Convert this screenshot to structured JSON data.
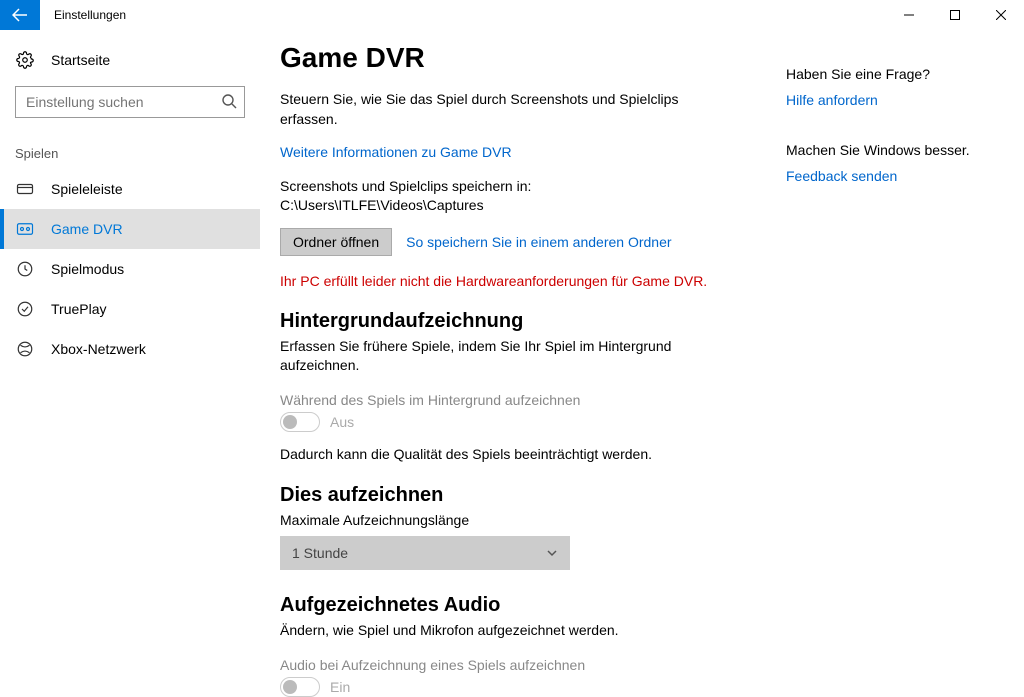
{
  "window": {
    "title": "Einstellungen"
  },
  "sidebar": {
    "home": "Startseite",
    "search_placeholder": "Einstellung suchen",
    "group": "Spielen",
    "items": [
      {
        "label": "Spieleleiste"
      },
      {
        "label": "Game DVR"
      },
      {
        "label": "Spielmodus"
      },
      {
        "label": "TruePlay"
      },
      {
        "label": "Xbox-Netzwerk"
      }
    ]
  },
  "main": {
    "title": "Game DVR",
    "intro": "Steuern Sie, wie Sie das Spiel durch Screenshots und Spielclips erfassen.",
    "more_info": "Weitere Informationen zu Game DVR",
    "save_path": "Screenshots und Spielclips speichern in: C:\\Users\\ITLFE\\Videos\\Captures",
    "open_folder": "Ordner öffnen",
    "save_elsewhere": "So speichern Sie in einem anderen Ordner",
    "warning": "Ihr PC erfüllt leider nicht die Hardwareanforderungen für Game DVR.",
    "bg": {
      "heading": "Hintergrundaufzeichnung",
      "sub": "Erfassen Sie frühere Spiele, indem Sie Ihr Spiel im Hintergrund aufzeichnen.",
      "option": "Während des Spiels im Hintergrund aufzeichnen",
      "state": "Aus",
      "note": "Dadurch kann die Qualität des Spiels beeinträchtigt werden."
    },
    "record": {
      "heading": "Dies aufzeichnen",
      "sub": "Maximale Aufzeichnungslänge",
      "value": "1 Stunde"
    },
    "audio": {
      "heading": "Aufgezeichnetes Audio",
      "sub": "Ändern, wie Spiel und Mikrofon aufgezeichnet werden.",
      "option": "Audio bei Aufzeichnung eines Spiels aufzeichnen",
      "state": "Ein"
    }
  },
  "right": {
    "q": "Haben Sie eine Frage?",
    "help": "Hilfe anfordern",
    "improve": "Machen Sie Windows besser.",
    "feedback": "Feedback senden"
  }
}
